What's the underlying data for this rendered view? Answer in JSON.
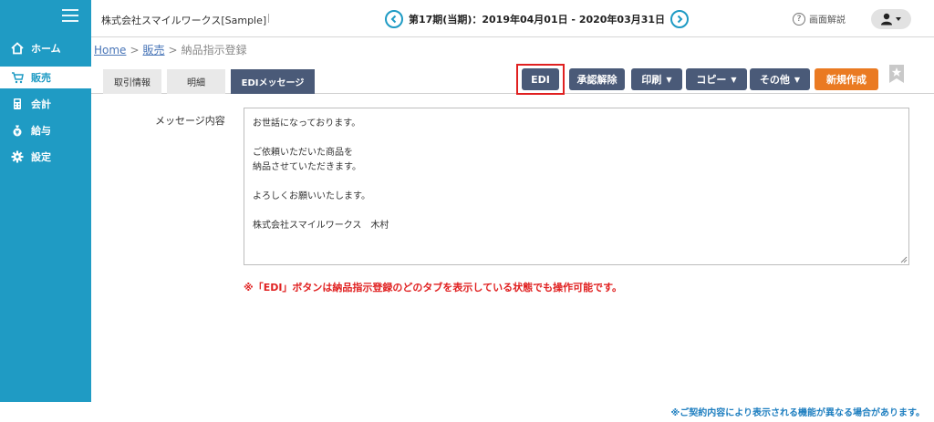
{
  "sidebar": {
    "items": [
      {
        "label": "ホーム",
        "icon": "home-icon"
      },
      {
        "label": "販売",
        "icon": "cart-icon"
      },
      {
        "label": "会計",
        "icon": "calculator-icon"
      },
      {
        "label": "給与",
        "icon": "money-bag-icon"
      },
      {
        "label": "設定",
        "icon": "gear-icon"
      }
    ],
    "active_index": 1
  },
  "header": {
    "company": "株式会社スマイルワークス[Sample]",
    "period": "第17期(当期)：2019年04月01日 - 2020年03月31日",
    "help_label": "画面解説"
  },
  "breadcrumb": {
    "home": "Home",
    "sales": "販売",
    "current": "納品指示登録"
  },
  "tabs": [
    {
      "label": "取引情報"
    },
    {
      "label": "明細"
    },
    {
      "label": "EDIメッセージ"
    }
  ],
  "actions": {
    "edi": "EDI",
    "approve_cancel": "承認解除",
    "print": "印刷",
    "copy": "コピー",
    "other": "その他",
    "new": "新規作成"
  },
  "message": {
    "label": "メッセージ内容",
    "content": "お世話になっております。\n\nご依頼いただいた商品を\n納品させていただきます。\n\nよろしくお願いいたします。\n\n株式会社スマイルワークス　木村"
  },
  "notes": {
    "edi_note": "※「EDI」ボタンは納品指示登録のどのタブを表示している状態でも操作可能です。",
    "contract_note": "※ご契約内容により表示される機能が異なる場合があります。"
  },
  "colors": {
    "sidebar": "#1f9bc4",
    "button": "#4a5a78",
    "new_button": "#ea7a22",
    "highlight": "#e02020"
  }
}
